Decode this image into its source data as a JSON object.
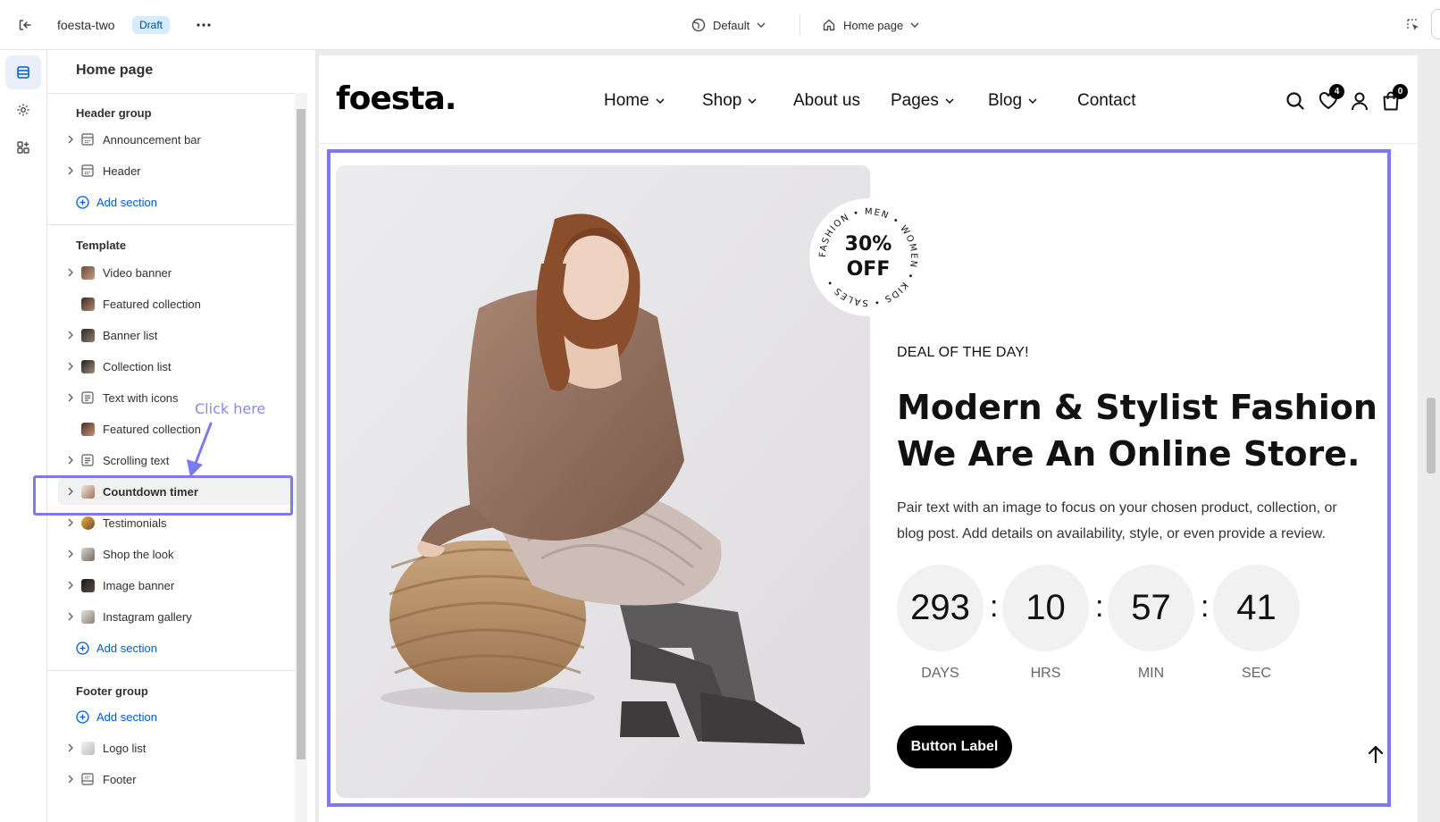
{
  "topbar": {
    "store_name": "foesta-two",
    "status_badge": "Draft",
    "theme_selector": "Default",
    "page_selector": "Home page"
  },
  "sidebar": {
    "title": "Home page",
    "header_group": {
      "title": "Header group",
      "items": [
        {
          "label": "Announcement bar",
          "icon": "layout-section-icon"
        },
        {
          "label": "Header",
          "icon": "layout-section-icon"
        }
      ],
      "add_label": "Add section"
    },
    "template": {
      "title": "Template",
      "items": [
        {
          "label": "Video banner",
          "icon": "thumbnail"
        },
        {
          "label": "Featured collection",
          "icon": "thumbnail"
        },
        {
          "label": "Banner list",
          "icon": "thumbnail"
        },
        {
          "label": "Collection list",
          "icon": "thumbnail"
        },
        {
          "label": "Text with icons",
          "icon": "text-block-icon"
        },
        {
          "label": "Featured collection",
          "icon": "thumbnail"
        },
        {
          "label": "Scrolling text",
          "icon": "text-block-icon"
        },
        {
          "label": "Countdown timer",
          "icon": "thumbnail",
          "selected": true
        },
        {
          "label": "Testimonials",
          "icon": "thumbnail"
        },
        {
          "label": "Shop the look",
          "icon": "thumbnail"
        },
        {
          "label": "Image banner",
          "icon": "thumbnail"
        },
        {
          "label": "Instagram gallery",
          "icon": "thumbnail"
        }
      ],
      "add_label": "Add section"
    },
    "footer_group": {
      "title": "Footer group",
      "add_label": "Add section",
      "items": [
        {
          "label": "Logo list",
          "icon": "thumbnail"
        },
        {
          "label": "Footer",
          "icon": "layout-section-icon"
        }
      ]
    }
  },
  "annotation": {
    "text": "Click here",
    "color": "#7d79f0"
  },
  "preview": {
    "logo": "foesta.",
    "nav": [
      {
        "label": "Home",
        "dropdown": true
      },
      {
        "label": "Shop",
        "dropdown": true
      },
      {
        "label": "About us",
        "dropdown": false
      },
      {
        "label": "Pages",
        "dropdown": true
      },
      {
        "label": "Blog",
        "dropdown": true
      },
      {
        "label": "Contact",
        "dropdown": false
      }
    ],
    "wishlist_count": "4",
    "cart_count": "0",
    "sticker": {
      "center_line1": "30%",
      "center_line2": "OFF",
      "ring_words": [
        "MEN",
        "WOMEN",
        "KIDS",
        "SALES",
        "FASHION"
      ]
    },
    "deal_label": "DEAL OF THE DAY!",
    "headline": "Modern & Stylist Fashion We Are An Online Store.",
    "description": "Pair text with an image to focus on your chosen product, collection, or blog post. Add details on availability, style, or even provide a review.",
    "countdown": [
      {
        "value": "293",
        "label": "DAYS"
      },
      {
        "value": "10",
        "label": "HRS"
      },
      {
        "value": "57",
        "label": "MIN"
      },
      {
        "value": "41",
        "label": "SEC"
      }
    ],
    "button_label": "Button Label"
  },
  "colors": {
    "accent": "#005bd3",
    "highlight": "#7d79f0",
    "badge_bg": "#d5ebff"
  }
}
